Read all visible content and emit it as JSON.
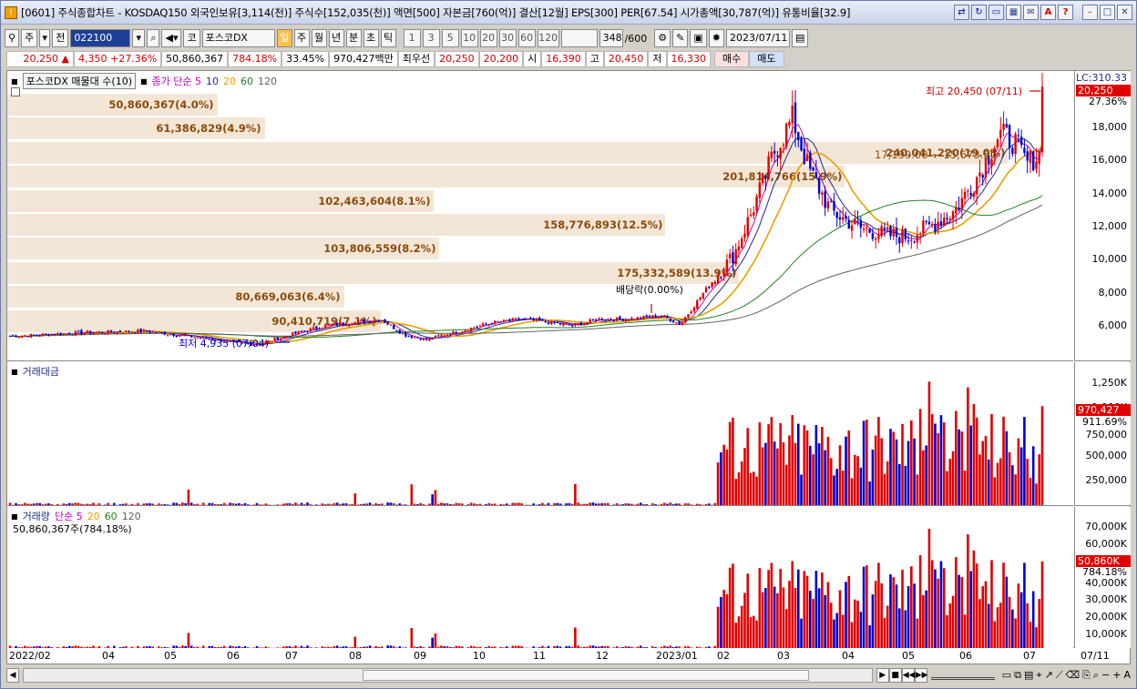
{
  "window": {
    "title": "[0601] 주식종합차트 - KOSDAQ150 외국인보유[3,114(천)] 주식수[152,035(천)] 액면[500] 자본금[760(억)] 결산[12월] EPS[300] PER[67.54] 시가총액[30,787(억)] 유통비율[32.9]",
    "app_icon": "I"
  },
  "toolbar": {
    "type_select": "주",
    "prev_label": "전",
    "code_value": "022100",
    "market_tag": "코",
    "stock_name": "포스코DX",
    "periods": [
      "일",
      "주",
      "월",
      "년",
      "분",
      "초",
      "틱"
    ],
    "active_period": "일",
    "intervals": [
      "1",
      "3",
      "5",
      "10",
      "20",
      "30",
      "60",
      "120"
    ],
    "count_value": "348",
    "count_total": "/600",
    "date_value": "2023/07/11"
  },
  "quote": {
    "price": "20,250",
    "direction": "▲",
    "change": "4,350",
    "change_pct": "+27.36%",
    "volume": "50,860,367",
    "volume_ratio": "784.18%",
    "turnover": "33.45%",
    "amount": "970,427백만",
    "priority_label": "최우선",
    "ask": "20,250",
    "bid": "20,200",
    "open_label": "시",
    "open": "16,390",
    "high_label": "고",
    "high": "20,450",
    "low_label": "저",
    "low": "16,330",
    "buy_label": "매수",
    "sell_label": "매도"
  },
  "price_panel": {
    "legend_box": "포스코DX 매물대 수(10)",
    "ma_label": "종가 단순 5",
    "ma_periods": [
      "10",
      "20",
      "60",
      "120"
    ],
    "lc_label": "LC:310.33",
    "last_price_tag": "20,250",
    "last_pct": "27.36%",
    "y_ticks": [
      "18,000",
      "16,000",
      "14,000",
      "12,000",
      "10,000",
      "8,000",
      "6,000"
    ],
    "high_annot": "최고 20,450 (07/11)",
    "low_annot": "최저 4,935 (07/04)",
    "dividend_annot": "배당락(0.00%)",
    "range_annot": "17,199.00 ~ 15,673.50",
    "volume_profile": [
      {
        "label": "50,860,367(4.0%)",
        "fraction": 0.04
      },
      {
        "label": "61,386,829(4.9%)",
        "fraction": 0.049
      },
      {
        "label": "240,041,220(19.0%)",
        "fraction": 0.19
      },
      {
        "label": "201,814,766(15.9%)",
        "fraction": 0.159
      },
      {
        "label": "102,463,604(8.1%)",
        "fraction": 0.081
      },
      {
        "label": "158,776,893(12.5%)",
        "fraction": 0.125
      },
      {
        "label": "103,806,559(8.2%)",
        "fraction": 0.082
      },
      {
        "label": "175,332,589(13.9%)",
        "fraction": 0.139
      },
      {
        "label": "80,669,063(6.4%)",
        "fraction": 0.064
      },
      {
        "label": "90,410,719(7.1%)",
        "fraction": 0.071
      }
    ]
  },
  "amount_panel": {
    "title": "거래대금",
    "y_ticks": [
      "1,250K",
      "1,000K",
      "750,000",
      "500,000",
      "250,000"
    ],
    "last_tag": "970,427",
    "last_pct": "911.69%"
  },
  "volume_panel": {
    "title": "거래량",
    "ma_label": "단순 5",
    "ma_periods": [
      "20",
      "60",
      "120"
    ],
    "sub_label": "50,860,367주(784.18%)",
    "y_ticks": [
      "70,000K",
      "60,000K",
      "50,000K",
      "40,000K",
      "30,000K",
      "20,000K",
      "10,000K"
    ],
    "last_tag": "50,860K",
    "last_pct": "784.18%"
  },
  "x_axis": {
    "labels": [
      "2022/02",
      "04",
      "05",
      "06",
      "07",
      "08",
      "09",
      "10",
      "11",
      "12",
      "2023/01",
      "02",
      "03",
      "04",
      "05",
      "06",
      "07"
    ],
    "right_label": "07/11"
  },
  "colors": {
    "up": "#e00000",
    "down": "#0000d0",
    "ma5": "#c000c0",
    "ma10": "#1e2a8c",
    "ma20": "#e8a000",
    "ma60": "#208020",
    "ma120": "#606060",
    "volume_profile": "#f4e6d6"
  }
}
